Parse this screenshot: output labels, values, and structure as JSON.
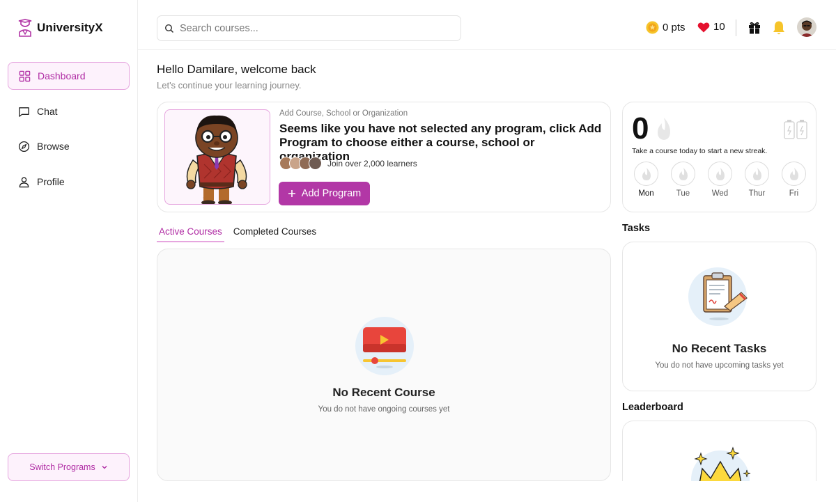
{
  "app": {
    "name": "UniversityX",
    "brand_color": "#b237a6"
  },
  "sidebar": {
    "items": [
      {
        "label": "Dashboard",
        "icon": "dashboard-grid-icon",
        "active": true
      },
      {
        "label": "Chat",
        "icon": "chat-bubble-icon",
        "active": false
      },
      {
        "label": "Browse",
        "icon": "compass-icon",
        "active": false
      },
      {
        "label": "Profile",
        "icon": "user-icon",
        "active": false
      }
    ],
    "switch_label": "Switch Programs"
  },
  "topbar": {
    "search_placeholder": "Search courses...",
    "points": "0 pts",
    "hearts": "10"
  },
  "greeting": {
    "title": "Hello Damilare, welcome back",
    "subtitle": "Let's continue your learning journey."
  },
  "program": {
    "eyebrow": "Add Course, School or Organization",
    "message": "Seems like you have not selected any program, click Add Program to choose either a course, school or organization",
    "learners": "Join over 2,000 learners",
    "button": "Add Program"
  },
  "streak": {
    "count": "0",
    "text": "Take a course today to start a new streak.",
    "days": [
      "Mon",
      "Tue",
      "Wed",
      "Thur",
      "Fri"
    ]
  },
  "courses": {
    "tabs": [
      "Active Courses",
      "Completed Courses"
    ],
    "empty_title": "No Recent Course",
    "empty_sub": "You do not have ongoing courses yet"
  },
  "tasks": {
    "title": "Tasks",
    "empty_title": "No Recent Tasks",
    "empty_sub": "You do not have upcoming tasks yet"
  },
  "leaderboard": {
    "title": "Leaderboard"
  }
}
